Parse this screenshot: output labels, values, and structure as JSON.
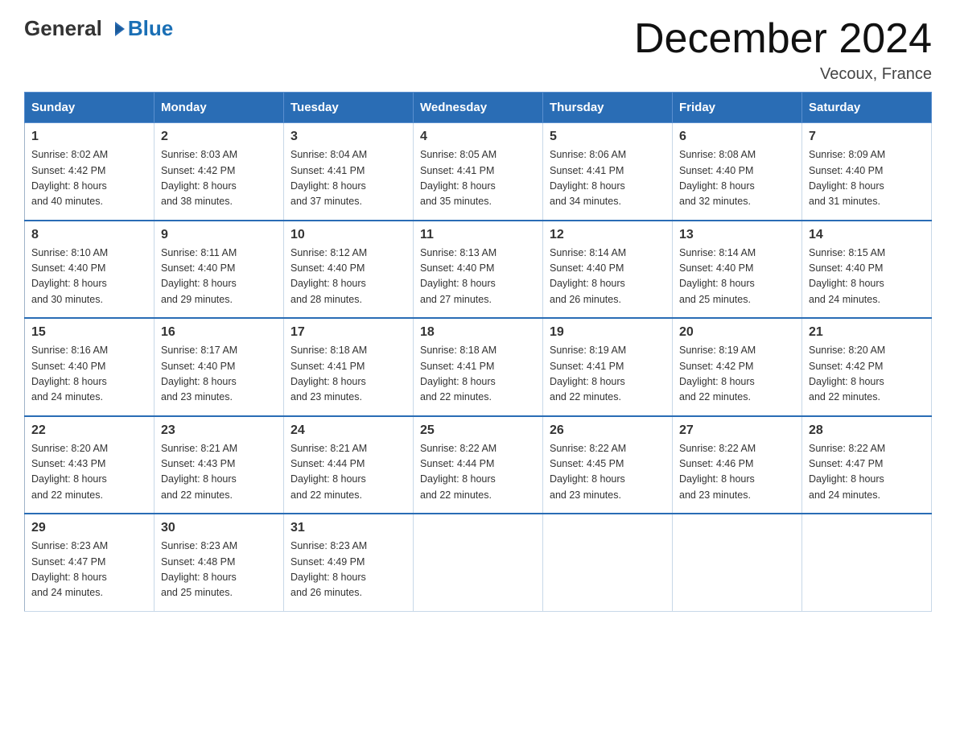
{
  "header": {
    "title": "December 2024",
    "location": "Vecoux, France",
    "logo_general": "General",
    "logo_blue": "Blue"
  },
  "days_of_week": [
    "Sunday",
    "Monday",
    "Tuesday",
    "Wednesday",
    "Thursday",
    "Friday",
    "Saturday"
  ],
  "weeks": [
    [
      {
        "day": "1",
        "sunrise": "8:02 AM",
        "sunset": "4:42 PM",
        "daylight": "8 hours and 40 minutes."
      },
      {
        "day": "2",
        "sunrise": "8:03 AM",
        "sunset": "4:42 PM",
        "daylight": "8 hours and 38 minutes."
      },
      {
        "day": "3",
        "sunrise": "8:04 AM",
        "sunset": "4:41 PM",
        "daylight": "8 hours and 37 minutes."
      },
      {
        "day": "4",
        "sunrise": "8:05 AM",
        "sunset": "4:41 PM",
        "daylight": "8 hours and 35 minutes."
      },
      {
        "day": "5",
        "sunrise": "8:06 AM",
        "sunset": "4:41 PM",
        "daylight": "8 hours and 34 minutes."
      },
      {
        "day": "6",
        "sunrise": "8:08 AM",
        "sunset": "4:40 PM",
        "daylight": "8 hours and 32 minutes."
      },
      {
        "day": "7",
        "sunrise": "8:09 AM",
        "sunset": "4:40 PM",
        "daylight": "8 hours and 31 minutes."
      }
    ],
    [
      {
        "day": "8",
        "sunrise": "8:10 AM",
        "sunset": "4:40 PM",
        "daylight": "8 hours and 30 minutes."
      },
      {
        "day": "9",
        "sunrise": "8:11 AM",
        "sunset": "4:40 PM",
        "daylight": "8 hours and 29 minutes."
      },
      {
        "day": "10",
        "sunrise": "8:12 AM",
        "sunset": "4:40 PM",
        "daylight": "8 hours and 28 minutes."
      },
      {
        "day": "11",
        "sunrise": "8:13 AM",
        "sunset": "4:40 PM",
        "daylight": "8 hours and 27 minutes."
      },
      {
        "day": "12",
        "sunrise": "8:14 AM",
        "sunset": "4:40 PM",
        "daylight": "8 hours and 26 minutes."
      },
      {
        "day": "13",
        "sunrise": "8:14 AM",
        "sunset": "4:40 PM",
        "daylight": "8 hours and 25 minutes."
      },
      {
        "day": "14",
        "sunrise": "8:15 AM",
        "sunset": "4:40 PM",
        "daylight": "8 hours and 24 minutes."
      }
    ],
    [
      {
        "day": "15",
        "sunrise": "8:16 AM",
        "sunset": "4:40 PM",
        "daylight": "8 hours and 24 minutes."
      },
      {
        "day": "16",
        "sunrise": "8:17 AM",
        "sunset": "4:40 PM",
        "daylight": "8 hours and 23 minutes."
      },
      {
        "day": "17",
        "sunrise": "8:18 AM",
        "sunset": "4:41 PM",
        "daylight": "8 hours and 23 minutes."
      },
      {
        "day": "18",
        "sunrise": "8:18 AM",
        "sunset": "4:41 PM",
        "daylight": "8 hours and 22 minutes."
      },
      {
        "day": "19",
        "sunrise": "8:19 AM",
        "sunset": "4:41 PM",
        "daylight": "8 hours and 22 minutes."
      },
      {
        "day": "20",
        "sunrise": "8:19 AM",
        "sunset": "4:42 PM",
        "daylight": "8 hours and 22 minutes."
      },
      {
        "day": "21",
        "sunrise": "8:20 AM",
        "sunset": "4:42 PM",
        "daylight": "8 hours and 22 minutes."
      }
    ],
    [
      {
        "day": "22",
        "sunrise": "8:20 AM",
        "sunset": "4:43 PM",
        "daylight": "8 hours and 22 minutes."
      },
      {
        "day": "23",
        "sunrise": "8:21 AM",
        "sunset": "4:43 PM",
        "daylight": "8 hours and 22 minutes."
      },
      {
        "day": "24",
        "sunrise": "8:21 AM",
        "sunset": "4:44 PM",
        "daylight": "8 hours and 22 minutes."
      },
      {
        "day": "25",
        "sunrise": "8:22 AM",
        "sunset": "4:44 PM",
        "daylight": "8 hours and 22 minutes."
      },
      {
        "day": "26",
        "sunrise": "8:22 AM",
        "sunset": "4:45 PM",
        "daylight": "8 hours and 23 minutes."
      },
      {
        "day": "27",
        "sunrise": "8:22 AM",
        "sunset": "4:46 PM",
        "daylight": "8 hours and 23 minutes."
      },
      {
        "day": "28",
        "sunrise": "8:22 AM",
        "sunset": "4:47 PM",
        "daylight": "8 hours and 24 minutes."
      }
    ],
    [
      {
        "day": "29",
        "sunrise": "8:23 AM",
        "sunset": "4:47 PM",
        "daylight": "8 hours and 24 minutes."
      },
      {
        "day": "30",
        "sunrise": "8:23 AM",
        "sunset": "4:48 PM",
        "daylight": "8 hours and 25 minutes."
      },
      {
        "day": "31",
        "sunrise": "8:23 AM",
        "sunset": "4:49 PM",
        "daylight": "8 hours and 26 minutes."
      },
      null,
      null,
      null,
      null
    ]
  ],
  "labels": {
    "sunrise": "Sunrise:",
    "sunset": "Sunset:",
    "daylight": "Daylight:"
  }
}
